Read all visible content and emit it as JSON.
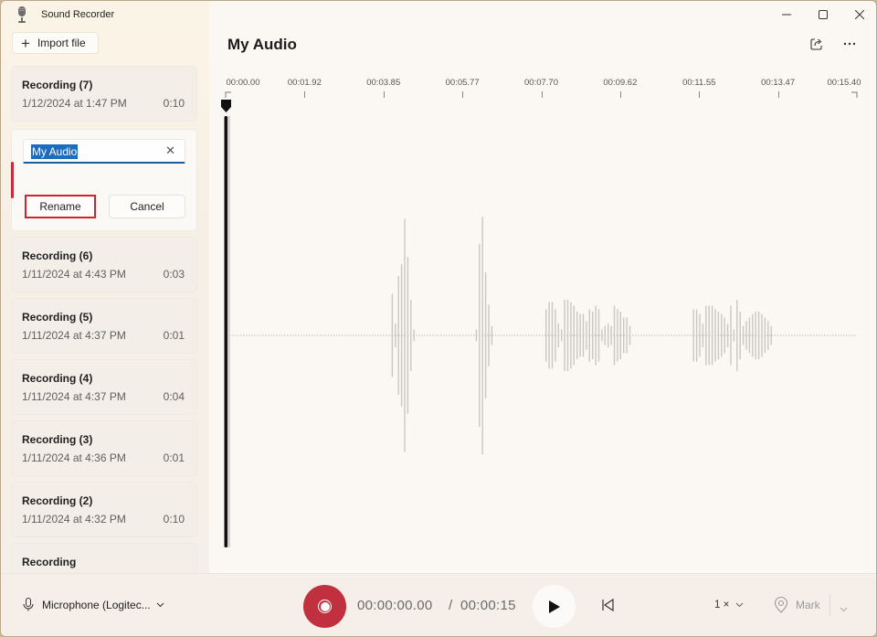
{
  "app": {
    "title": "Sound Recorder",
    "import_label": "Import file"
  },
  "window_controls": [
    "minimize",
    "maximize",
    "close"
  ],
  "recordings": [
    {
      "name": "Recording (7)",
      "date": "1/12/2024 at 1:47 PM",
      "duration": "0:10"
    },
    {
      "name": "Recording (6)",
      "date": "1/11/2024 at 4:43 PM",
      "duration": "0:03"
    },
    {
      "name": "Recording (5)",
      "date": "1/11/2024 at 4:37 PM",
      "duration": "0:01"
    },
    {
      "name": "Recording (4)",
      "date": "1/11/2024 at 4:37 PM",
      "duration": "0:04"
    },
    {
      "name": "Recording (3)",
      "date": "1/11/2024 at 4:36 PM",
      "duration": "0:01"
    },
    {
      "name": "Recording (2)",
      "date": "1/11/2024 at 4:32 PM",
      "duration": "0:10"
    },
    {
      "name": "Recording",
      "date": "",
      "duration": ""
    }
  ],
  "rename": {
    "input_value": "My Audio",
    "rename_label": "Rename",
    "cancel_label": "Cancel"
  },
  "main": {
    "title": "My Audio",
    "timeline_ticks": [
      "00:00.00",
      "00:01.92",
      "00:03.85",
      "00:05.77",
      "00:07.70",
      "00:09.62",
      "00:11.55",
      "00:13.47",
      "00:15.40"
    ],
    "total_seconds": 15.4,
    "playhead_seconds": 0,
    "waveform": {
      "bursts": [
        {
          "start": 4.05,
          "amps": [
            0.35,
            0.1,
            0.5,
            0.6,
            0.98,
            0.66,
            0.3,
            0.05
          ]
        },
        {
          "start": 6.1,
          "amps": [
            0.05,
            0.77,
            1.0,
            0.53,
            0.26,
            0.08
          ]
        },
        {
          "start": 7.8,
          "amps": [
            0.22,
            0.28,
            0.28,
            0.22,
            0.1,
            0.05,
            0.3,
            0.3,
            0.28,
            0.25,
            0.2,
            0.18,
            0.18,
            0.12,
            0.22,
            0.2,
            0.25,
            0.22,
            0.05,
            0.08,
            0.1,
            0.08,
            0.25,
            0.22,
            0.2,
            0.15,
            0.15,
            0.08
          ]
        },
        {
          "start": 11.4,
          "amps": [
            0.22,
            0.22,
            0.18,
            0.1,
            0.25,
            0.25,
            0.25,
            0.22,
            0.2,
            0.18,
            0.15,
            0.1,
            0.25,
            0.05,
            0.3,
            0.2,
            0.08,
            0.12,
            0.15,
            0.18,
            0.2,
            0.2,
            0.18,
            0.15,
            0.12,
            0.08
          ]
        }
      ]
    }
  },
  "bottom": {
    "microphone_label": "Microphone (Logitec...",
    "current_time": "00:00:00.00",
    "separator": "/",
    "total_time": "00:00:15",
    "speed_label": "1 ×",
    "mark_label": "Mark"
  },
  "colors": {
    "record": "#c1303e",
    "selection_highlight": "#1e6cc0",
    "rename_border": "#d0222f",
    "waveform": "#c9c6c3",
    "playhead": "#111111"
  }
}
